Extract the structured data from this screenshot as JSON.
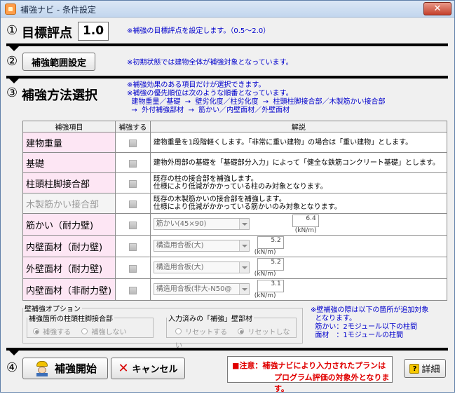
{
  "window": {
    "title": "補強ナビ - 条件設定",
    "close_label": "✕"
  },
  "target": {
    "num": "①",
    "label": "目標評点",
    "value": "1.0",
    "note": "※補強の目標評点を設定します。（0.5～2.0）"
  },
  "range": {
    "num": "②",
    "button_label": "補強範囲設定",
    "note": "※初期状態では建物全体が補強対象となっています。"
  },
  "method": {
    "num": "③",
    "label": "補強方法選択",
    "notes": [
      "※補強効果のある項目だけが選択できます。",
      "※補強の優先順位は次のような順番となっています。",
      "  建物重量／基礎  →  壁劣化度／柱劣化度  →  柱頭柱脚接合部／木製筋かい接合部",
      "  →  外付補強部材  →  筋かい／内壁面材／外壁面材"
    ]
  },
  "table": {
    "headers": [
      "補強項目",
      "補強する",
      "解説"
    ],
    "rows": [
      {
        "label": "建物重量",
        "desc": "建物重量を1段階軽くします。「非常に重い建物」の場合は「重い建物」とします。"
      },
      {
        "label": "基礎",
        "desc": "建物外周部の基礎を「基礎部分入力」によって「健全な鉄筋コンクリート基礎」とします。"
      },
      {
        "label": "柱頭柱脚接合部",
        "desc1": "既存の柱の接合部を補強します。",
        "desc2": "仕様により低減がかかっている柱のみ対象となります。"
      },
      {
        "label": "木製筋かい接合部",
        "desc1": "既存の木製筋かいの接合部を補強します。",
        "desc2": "仕様により低減がかかっている筋かいのみ対象となります。"
      },
      {
        "label": "筋かい（耐力壁)",
        "select": "筋かい(45×90)",
        "value": "6.4",
        "unit": "(kN/m)"
      },
      {
        "label": "内壁面材（耐力壁)",
        "select": "構造用合板(大)",
        "value": "5.2",
        "unit": "(kN/m)"
      },
      {
        "label": "外壁面材（耐力壁)",
        "select": "構造用合板(大)",
        "value": "5.2",
        "unit": "(kN/m)"
      },
      {
        "label": "内壁面材（非耐力壁)",
        "select": "構造用合板(非大-N50@",
        "value": "3.1",
        "unit": "(kN/m)"
      }
    ]
  },
  "options": {
    "legend": "壁補強オプション",
    "group1": {
      "legend": "補強箇所の柱頭柱脚接合部",
      "opt1": "補強する",
      "opt2": "補強しない"
    },
    "group2": {
      "legend": "入力済みの「補強」壁部材",
      "opt1": "リセットする",
      "opt2": "リセットしない"
    },
    "note": [
      "※壁補強の際は以下の箇所が追加対象",
      "  となります。",
      "  筋かい：2モジュール以下の柱間",
      "  面材　：1モジュールの柱間"
    ]
  },
  "bottom": {
    "num": "④",
    "start_label": "補強開始",
    "cancel_label": "キャンセル",
    "warning1": "■注意：補強ナビにより入力されたプランは",
    "warning2": "プログラム評価の対象外となります。",
    "detail_label": "詳細"
  }
}
